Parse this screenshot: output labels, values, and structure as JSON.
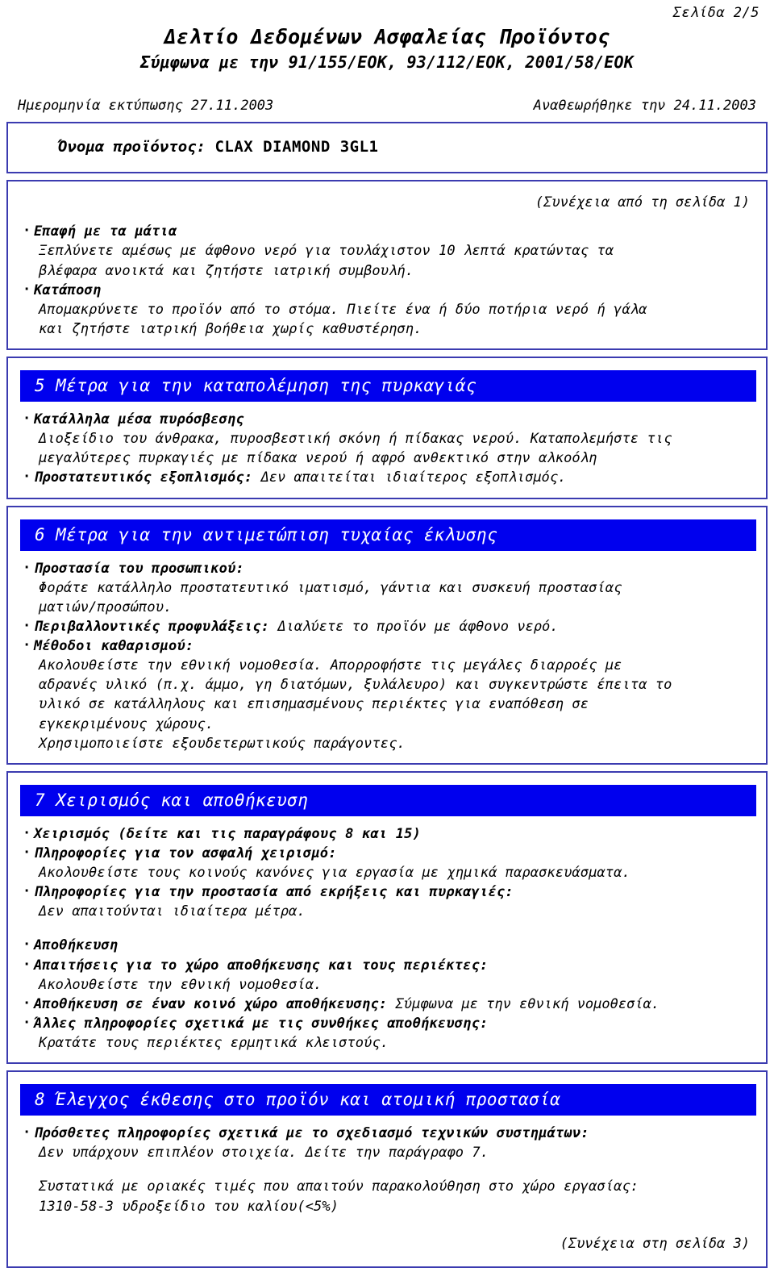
{
  "header": {
    "page_number": "Σελίδα 2/5",
    "title": "Δελτίο Δεδομένων Ασφαλείας Προϊόντος",
    "subtitle": "Σύμφωνα με την 91/155/ΕΟΚ, 93/112/ΕΟΚ, 2001/58/ΕΟΚ",
    "print_date": "Ημερομηνία εκτύπωσης 27.11.2003",
    "revision_date": "Αναθεωρήθηκε την 24.11.2003"
  },
  "product": {
    "label": "Όνομα προϊόντος:",
    "name": "CLAX DIAMOND 3GL1"
  },
  "continued": {
    "from": "(Συνέχεια από τη σελίδα 1)",
    "to": "(Συνέχεια στη σελίδα 3)"
  },
  "first_aid": {
    "eye_heading": "Επαφή με τα μάτια",
    "eye_text_1": "Ξεπλύνετε αμέσως με άφθονο νερό για τουλάχιστον 10 λεπτά κρατώντας τα",
    "eye_text_2": "βλέφαρα ανοικτά και ζητήστε ιατρική συμβουλή.",
    "ingestion_heading": "Κατάποση",
    "ingestion_text_1": "Απομακρύνετε το προϊόν από το στόμα. Πιείτε ένα ή δύο ποτήρια νερό ή γάλα",
    "ingestion_text_2": "και ζητήστε ιατρική βοήθεια χωρίς καθυστέρηση."
  },
  "section5": {
    "bar": "5 Μέτρα για την καταπολέμηση της πυρκαγιάς",
    "media_heading": "Κατάλληλα μέσα πυρόσβεσης",
    "media_text_1": "Διοξείδιο του άνθρακα, πυροσβεστική σκόνη ή πίδακας νερού. Καταπολεμήστε τις",
    "media_text_2": "μεγαλύτερες πυρκαγιές με πίδακα νερού ή αφρό ανθεκτικό στην αλκοόλη",
    "equipment_heading": "Προστατευτικός εξοπλισμός:",
    "equipment_text": "Δεν απαιτείται ιδιαίτερος εξοπλισμός."
  },
  "section6": {
    "bar": "6 Μέτρα για την αντιμετώπιση τυχαίας έκλυσης",
    "personal_heading": "Προστασία του προσωπικού:",
    "personal_text_1": "Φοράτε κατάλληλο προστατευτικό ιματισμό, γάντια και συσκευή προστασίας",
    "personal_text_2": "ματιών/προσώπου.",
    "env_heading": "Περιβαλλοντικές προφυλάξεις:",
    "env_text": "Διαλύετε το προϊόν με άφθονο νερό.",
    "cleanup_heading": "Μέθοδοι καθαρισμού:",
    "cleanup_text_1": "Ακολουθείστε την εθνική νομοθεσία. Απορροφήστε τις μεγάλες διαρροές με",
    "cleanup_text_2": "αδρανές υλικό (π.χ. άμμο, γη διατόμων, ξυλάλευρο) και συγκεντρώστε έπειτα το",
    "cleanup_text_3": "υλικό σε κατάλληλους και επισημασμένους περιέκτες για εναπόθεση σε",
    "cleanup_text_4": "εγκεκριμένους χώρους.",
    "cleanup_text_5": "Χρησιμοποιείστε εξουδετερωτικούς παράγοντες."
  },
  "section7": {
    "bar": "7 Χειρισμός και αποθήκευση",
    "handling_heading": "Χειρισμός (δείτε και τις παραγράφους 8 και 15)",
    "safe_handling_heading": "Πληροφορίες για τον ασφαλή χειρισμό:",
    "safe_handling_text": "Ακολουθείστε τους κοινούς κανόνες για εργασία με χημικά παρασκευάσματα.",
    "explosion_heading": "Πληροφορίες για την προστασία από εκρήξεις και πυρκαγιές:",
    "explosion_text": "Δεν απαιτούνται ιδιαίτερα μέτρα.",
    "storage_heading": "Αποθήκευση",
    "storage_req_heading": "Απαιτήσεις για το χώρο αποθήκευσης και τους περιέκτες:",
    "storage_req_text": "Ακολουθείστε την εθνική νομοθεσία.",
    "common_storage_heading": "Αποθήκευση σε έναν κοινό χώρο αποθήκευσης:",
    "common_storage_text": "Σύμφωνα με την εθνική νομοθεσία.",
    "other_storage_heading": "Άλλες πληροφορίες σχετικά με τις συνθήκες αποθήκευσης:",
    "other_storage_text": "Κρατάτε τους περιέκτες ερμητικά κλειστούς."
  },
  "section8": {
    "bar": "8 Έλεγχος έκθεσης στο προϊόν και ατομική προστασία",
    "technical_heading": "Πρόσθετες πληροφορίες σχετικά με το σχεδιασμό τεχνικών συστημάτων:",
    "technical_text": "Δεν υπάρχουν επιπλέον στοιχεία. Δείτε την παράγραφο 7.",
    "limits_text": "Συστατικά με οριακές τιμές που απαιτούν παρακολούθηση στο χώρο εργασίας:",
    "limits_value": "1310-58-3 υδροξείδιο του καλίου(<5%)"
  },
  "colors": {
    "border": "#3b3bb0",
    "section_bar": "#0000ee",
    "section_bar_text": "#ffffff",
    "text": "#000000"
  }
}
